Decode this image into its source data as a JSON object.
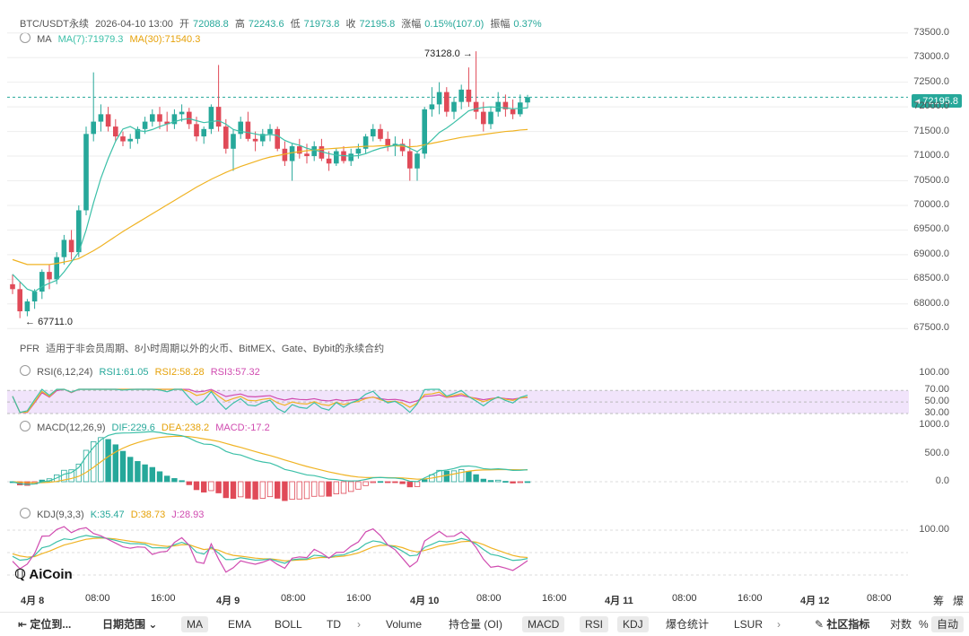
{
  "header": {
    "symbol": "BTC/USDT永续",
    "datetime": "2026-04-10 13:00",
    "open_label": "开",
    "open": "72088.8",
    "high_label": "高",
    "high": "72243.6",
    "low_label": "低",
    "low": "71973.8",
    "close_label": "收",
    "close": "72195.8",
    "change_label": "涨幅",
    "change": "0.15%(107.0)",
    "amp_label": "振幅",
    "amp": "0.37%"
  },
  "ma": {
    "name": "MA",
    "ma7": "MA(7):71979.3",
    "ma30": "MA(30):71540.3"
  },
  "pfr": {
    "name": "PFR",
    "text": "适用于非会员周期、8小时周期以外的火币、BitMEX、Gate、Bybit的永续合约"
  },
  "rsi": {
    "name": "RSI(6,12,24)",
    "rsi1": "RSI1:61.05",
    "rsi2": "RSI2:58.28",
    "rsi3": "RSI3:57.32"
  },
  "macd": {
    "name": "MACD(12,26,9)",
    "dif": "DIF:229.6",
    "dea": "DEA:238.2",
    "macd": "MACD:-17.2"
  },
  "kdj": {
    "name": "KDJ(9,3,3)",
    "k": "K:35.47",
    "d": "D:38.73",
    "j": "J:28.93"
  },
  "price_axis": [
    "73500.0",
    "73000.0",
    "72500.0",
    "72000.0",
    "71500.0",
    "71000.0",
    "70500.0",
    "70000.0",
    "69500.0",
    "69000.0",
    "68500.0",
    "68000.0",
    "67500.0"
  ],
  "current_price": "72195.8",
  "high_annotation": "73128.0",
  "low_annotation": "67711.0",
  "rsi_axis": [
    "100.00",
    "70.00",
    "50.00",
    "30.00"
  ],
  "macd_axis": [
    "1000.0",
    "500.0",
    "0.0"
  ],
  "kdj_axis": [
    "100.00"
  ],
  "time_axis": [
    "4月 8",
    "08:00",
    "16:00",
    "4月 9",
    "08:00",
    "16:00",
    "4月 10",
    "08:00",
    "16:00",
    "4月 11",
    "08:00",
    "16:00",
    "4月 12",
    "08:00"
  ],
  "logo": "AiCoin",
  "toolbar": {
    "locate": "定位到...",
    "date_range": "日期范围",
    "indicators": [
      "MA",
      "EMA",
      "BOLL",
      "TD"
    ],
    "sub_indicators": [
      "Volume",
      "持仓量 (OI)",
      "MACD",
      "RSI",
      "KDJ",
      "爆仓统计",
      "LSUR"
    ],
    "community": "社区指标",
    "log": "对数",
    "percent": "%",
    "auto": "自动",
    "chevron": "›",
    "corner_right": "爆",
    "corner_left": "筹"
  },
  "colors": {
    "up": "#26a89a",
    "down": "#e04a58",
    "ma7": "#3cc0a8",
    "ma30": "#f0b323",
    "rsi3": "#d04bb0",
    "grid": "#eeeeee"
  },
  "chart_data": {
    "type": "candlestick",
    "interval": "1h",
    "candles": [
      [
        68400,
        68600,
        68200,
        68300
      ],
      [
        68300,
        68450,
        67711,
        67850
      ],
      [
        67850,
        68100,
        67750,
        68050
      ],
      [
        68050,
        68300,
        67900,
        68250
      ],
      [
        68250,
        68700,
        68100,
        68650
      ],
      [
        68650,
        68800,
        68300,
        68500
      ],
      [
        68500,
        69050,
        68400,
        68950
      ],
      [
        68950,
        69400,
        68800,
        69300
      ],
      [
        69300,
        69500,
        68900,
        69050
      ],
      [
        69050,
        70000,
        68950,
        69900
      ],
      [
        69900,
        71600,
        69800,
        71450
      ],
      [
        71450,
        72700,
        71300,
        71700
      ],
      [
        71700,
        72050,
        71500,
        71850
      ],
      [
        71850,
        72000,
        71500,
        71600
      ],
      [
        71600,
        71750,
        71300,
        71400
      ],
      [
        71400,
        71500,
        71200,
        71300
      ],
      [
        71300,
        71450,
        71150,
        71350
      ],
      [
        71350,
        71600,
        71250,
        71550
      ],
      [
        71550,
        71800,
        71450,
        71700
      ],
      [
        71700,
        71950,
        71600,
        71850
      ],
      [
        71850,
        72000,
        71550,
        71700
      ],
      [
        71700,
        71900,
        71500,
        71650
      ],
      [
        71650,
        71950,
        71550,
        71850
      ],
      [
        71850,
        72050,
        71700,
        71900
      ],
      [
        71900,
        71980,
        71550,
        71650
      ],
      [
        71650,
        71800,
        71300,
        71400
      ],
      [
        71400,
        71600,
        71250,
        71550
      ],
      [
        71550,
        72050,
        71450,
        72000
      ],
      [
        72000,
        72850,
        71500,
        71600
      ],
      [
        71600,
        71750,
        71050,
        71150
      ],
      [
        71150,
        71550,
        70700,
        71450
      ],
      [
        71450,
        71800,
        71350,
        71700
      ],
      [
        71700,
        71900,
        71300,
        71350
      ],
      [
        71350,
        71500,
        71100,
        71300
      ],
      [
        71300,
        71550,
        71200,
        71450
      ],
      [
        71450,
        71650,
        71300,
        71550
      ],
      [
        71550,
        71600,
        71100,
        71150
      ],
      [
        71150,
        71300,
        70800,
        70900
      ],
      [
        70900,
        71250,
        70500,
        71200
      ],
      [
        71200,
        71350,
        70950,
        71050
      ],
      [
        71050,
        71250,
        70850,
        71000
      ],
      [
        71000,
        71300,
        70900,
        71200
      ],
      [
        71200,
        71350,
        70900,
        70950
      ],
      [
        70950,
        71100,
        70700,
        70850
      ],
      [
        70850,
        71150,
        70800,
        71100
      ],
      [
        71100,
        71200,
        70850,
        70900
      ],
      [
        70900,
        71150,
        70800,
        71050
      ],
      [
        71050,
        71250,
        70950,
        71150
      ],
      [
        71150,
        71450,
        71050,
        71400
      ],
      [
        71400,
        71650,
        71300,
        71550
      ],
      [
        71550,
        71650,
        71300,
        71350
      ],
      [
        71350,
        71500,
        71100,
        71200
      ],
      [
        71200,
        71400,
        71000,
        71250
      ],
      [
        71250,
        71350,
        71000,
        71100
      ],
      [
        71100,
        71350,
        70500,
        70750
      ],
      [
        70750,
        71100,
        70500,
        71050
      ],
      [
        71050,
        72000,
        70950,
        71950
      ],
      [
        71950,
        72400,
        71800,
        72050
      ],
      [
        72050,
        72500,
        71850,
        72300
      ],
      [
        72300,
        72400,
        71800,
        71900
      ],
      [
        71900,
        72200,
        71750,
        72100
      ],
      [
        72100,
        72450,
        71950,
        72350
      ],
      [
        72350,
        72800,
        72000,
        72100
      ],
      [
        72100,
        73128,
        71750,
        71900
      ],
      [
        71900,
        72100,
        71500,
        71650
      ],
      [
        71650,
        72000,
        71550,
        71900
      ],
      [
        71900,
        72300,
        71800,
        72100
      ],
      [
        72100,
        72250,
        71800,
        71950
      ],
      [
        71950,
        72150,
        71750,
        71850
      ],
      [
        71850,
        72250,
        71800,
        72088.8
      ],
      [
        72088.8,
        72243.6,
        71973.8,
        72195.8
      ]
    ],
    "ma7": [
      68600,
      68450,
      68300,
      68250,
      68350,
      68420,
      68480,
      68650,
      68850,
      69050,
      69500,
      70050,
      70550,
      70950,
      71300,
      71550,
      71600,
      71520,
      71500,
      71540,
      71600,
      71650,
      71700,
      71740,
      71760,
      71720,
      71680,
      71700,
      71720,
      71650,
      71540,
      71500,
      71480,
      71450,
      71420,
      71440,
      71420,
      71320,
      71260,
      71220,
      71160,
      71120,
      71090,
      71050,
      71020,
      71010,
      71000,
      71010,
      71050,
      71110,
      71160,
      71190,
      71220,
      71230,
      71160,
      71090,
      71200,
      71330,
      71480,
      71570,
      71680,
      71800,
      71920,
      71960,
      71990,
      72000,
      71990,
      71980,
      71960,
      71970,
      71979.3
    ],
    "ma30": [
      68900,
      68850,
      68800,
      68800,
      68800,
      68800,
      68820,
      68850,
      68880,
      68920,
      69000,
      69080,
      69170,
      69270,
      69370,
      69470,
      69560,
      69650,
      69740,
      69830,
      69920,
      70010,
      70100,
      70190,
      70280,
      70370,
      70450,
      70530,
      70600,
      70670,
      70730,
      70790,
      70840,
      70890,
      70940,
      70980,
      71010,
      71040,
      71070,
      71090,
      71110,
      71120,
      71140,
      71150,
      71160,
      71170,
      71180,
      71190,
      71200,
      71200,
      71210,
      71210,
      71210,
      71200,
      71190,
      71200,
      71230,
      71260,
      71290,
      71320,
      71350,
      71380,
      71400,
      71420,
      71440,
      71460,
      71480,
      71500,
      71510,
      71530,
      71540.3
    ],
    "rsi_range": [
      0,
      100
    ],
    "macd_range": [
      -450,
      1050
    ],
    "kdj_range": [
      0,
      130
    ],
    "price_range": [
      67250,
      73750
    ]
  }
}
